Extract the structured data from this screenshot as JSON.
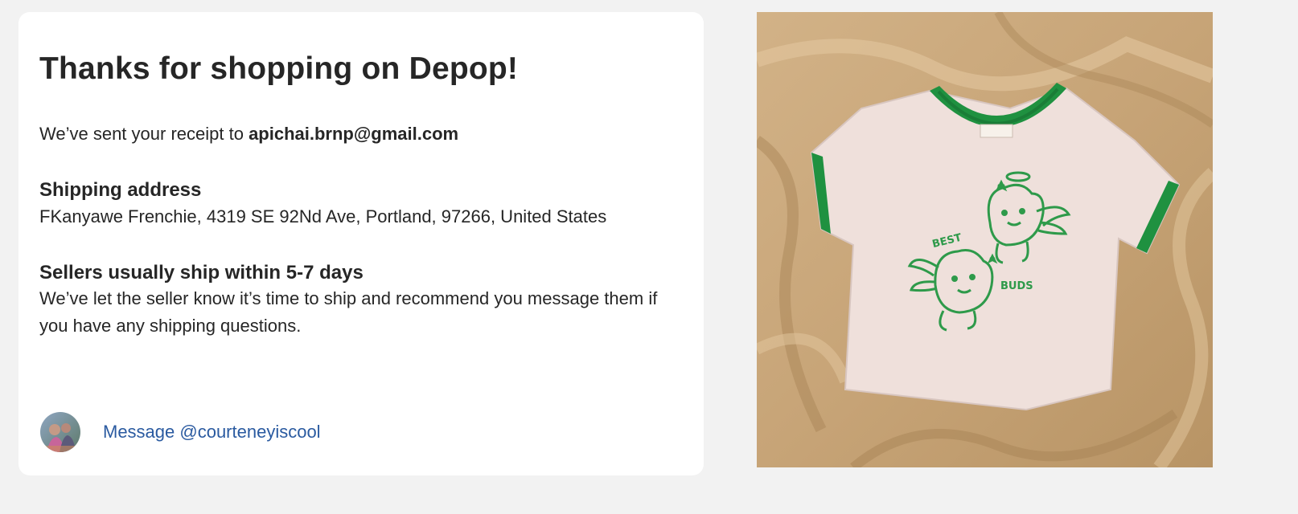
{
  "confirmation": {
    "title": "Thanks for shopping on Depop!",
    "receipt_prefix": "We’ve sent your receipt to",
    "email": "apichai.brnp@gmail.com"
  },
  "shipping": {
    "heading": "Shipping address",
    "address": "FKanyawe Frenchie, 4319 SE 92Nd Ave, Portland, 97266, United States"
  },
  "sellers": {
    "heading": "Sellers usually ship within 5-7 days",
    "body": "We’ve let the seller know it’s time to ship and recommend you message them if you have any shipping questions."
  },
  "message": {
    "label": "Message @courteneyiscool",
    "link_color": "#2a5aa0"
  },
  "product_image": {
    "shirt_text_top": "BEST",
    "shirt_text_bottom": "BUDS",
    "shirt_color": "#efe0db",
    "trim_color": "#1f9140",
    "background_color": "#c9a67a"
  }
}
